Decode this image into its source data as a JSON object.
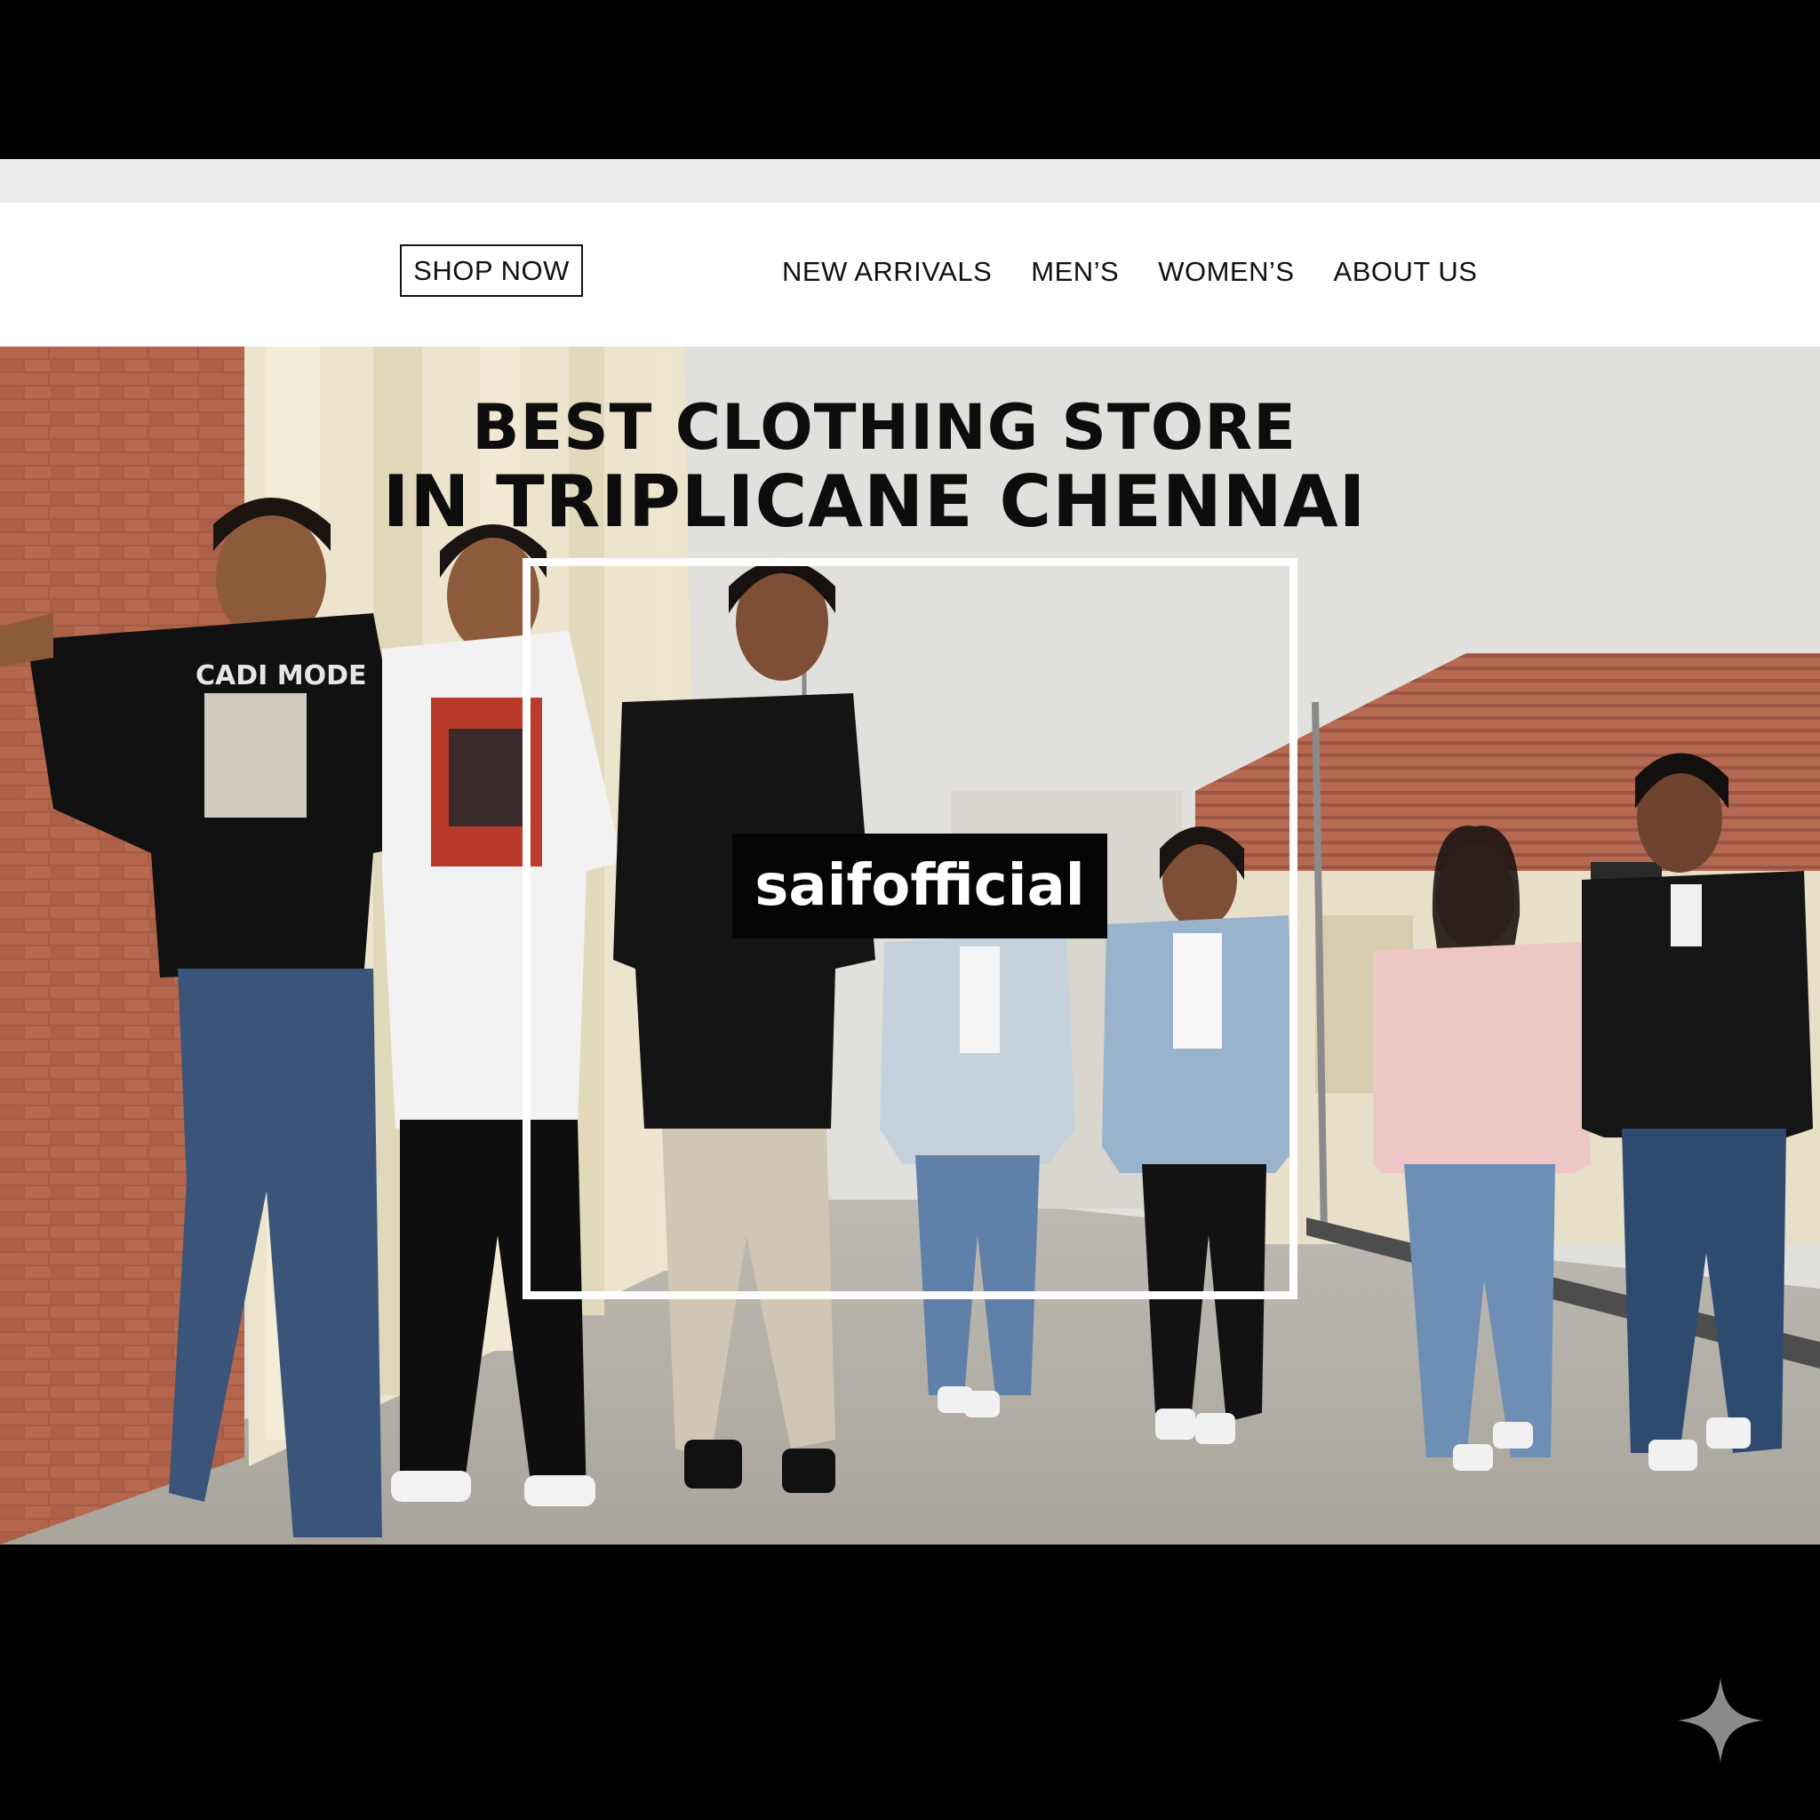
{
  "nav": {
    "shop_now": "SHOP NOW",
    "links": [
      "NEW ARRIVALS",
      "MEN’S",
      "WOMEN’S",
      "ABOUT US"
    ]
  },
  "hero": {
    "title_line1": "BEST CLOTHING STORE",
    "title_line2": "IN TRIPLICANE CHENNAI",
    "brand": "saifofficial",
    "tshirt_print": "CADI MODE"
  },
  "icons": {
    "sparkle": "sparkle-icon"
  },
  "colors": {
    "brick": "#a45a43",
    "roof": "#b66a52",
    "badge": "#050505",
    "frame": "#ffffff"
  }
}
